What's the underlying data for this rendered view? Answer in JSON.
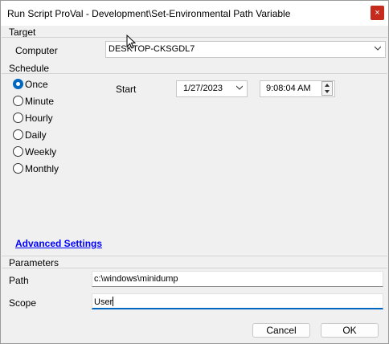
{
  "window": {
    "title": "Run Script ProVal - Development\\Set-Environmental Path Variable",
    "close_glyph": "×"
  },
  "target": {
    "section_label": "Target",
    "computer_label": "Computer",
    "computer_value": "DESKTOP-CKSGDL7"
  },
  "schedule": {
    "section_label": "Schedule",
    "options": [
      "Once",
      "Minute",
      "Hourly",
      "Daily",
      "Weekly",
      "Monthly"
    ],
    "selected": "Once",
    "start_label": "Start",
    "start_date": "1/27/2023",
    "start_time": "9:08:04 AM"
  },
  "advanced_settings_label": "Advanced Settings",
  "parameters": {
    "section_label": "Parameters",
    "path_label": "Path",
    "path_value": "c:\\windows\\minidump",
    "scope_label": "Scope",
    "scope_value": "User"
  },
  "buttons": {
    "cancel": "Cancel",
    "ok": "OK"
  },
  "icons": {
    "close": "close-icon",
    "dropdown": "chevron-down-icon",
    "spin": "spin-buttons",
    "cursor": "mouse-pointer"
  },
  "colors": {
    "accent": "#0067c0",
    "close_button": "#c42b1c",
    "link": "#0000ff"
  }
}
